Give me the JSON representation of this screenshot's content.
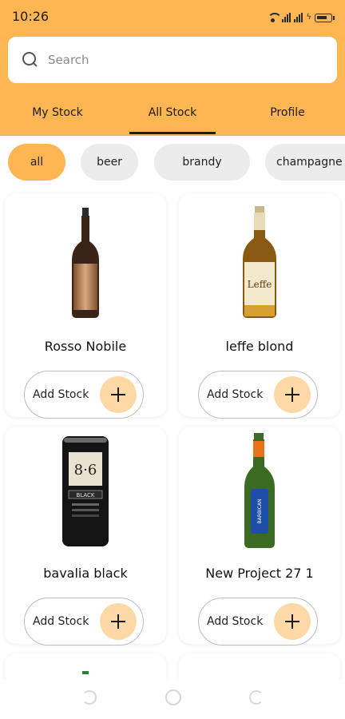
{
  "status_bar": {
    "time": "10:26"
  },
  "search": {
    "placeholder": "Search",
    "value": ""
  },
  "tabs": [
    {
      "label": "My Stock",
      "active": false
    },
    {
      "label": "All Stock",
      "active": true
    },
    {
      "label": "Profile",
      "active": false
    }
  ],
  "categories": [
    {
      "label": "all",
      "active": true
    },
    {
      "label": "beer",
      "active": false
    },
    {
      "label": "brandy",
      "active": false
    },
    {
      "label": "champagne",
      "active": false
    }
  ],
  "products": [
    {
      "name": "Rosso Nobile",
      "button_label": "Add Stock",
      "image": "red-wine-bottle"
    },
    {
      "name": "leffe blond",
      "button_label": "Add Stock",
      "image": "beer-bottle"
    },
    {
      "name": "bavalia black",
      "button_label": "Add Stock",
      "image": "beer-can"
    },
    {
      "name": "New Project 27 1",
      "button_label": "Add Stock",
      "image": "green-beer-bottle"
    }
  ],
  "colors": {
    "accent": "#FDB652",
    "accent_light": "#FDD9A6",
    "chip_inactive": "#ECECEC"
  }
}
